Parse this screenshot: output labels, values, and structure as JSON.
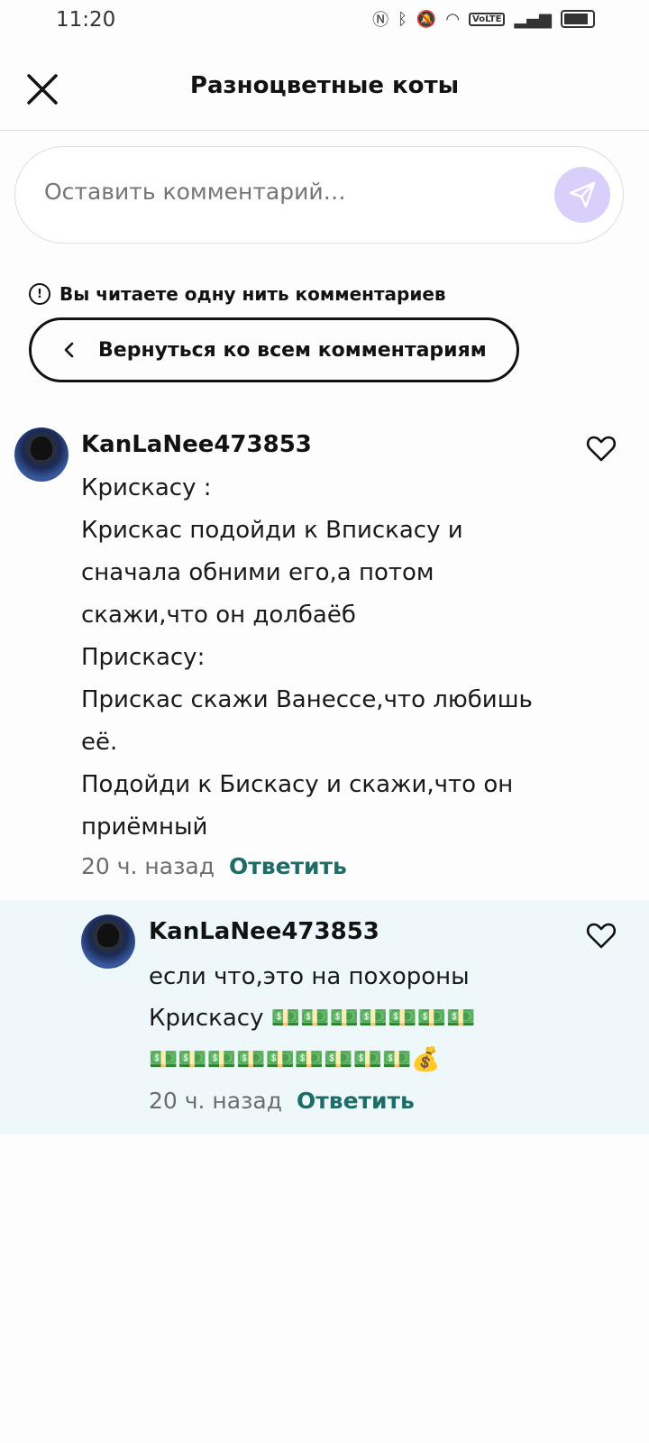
{
  "status": {
    "time": "11:20",
    "volte": "VoLTE"
  },
  "header": {
    "title": "Разноцветные коты"
  },
  "comment_input": {
    "placeholder": "Оставить комментарий…"
  },
  "thread": {
    "notice": "Вы читаете одну нить комментариев",
    "back_label": "Вернуться ко всем комментариям"
  },
  "comments": [
    {
      "username": "KanLaNee473853",
      "text": "Крискасу :\nКрискас подойди к Впискасу и\nсначала обними его,а потом\nскажи,что он долбаёб\nПрискасу:\nПрискас скажи Ванессе,что любишь\neё.\nПодойди к Бискасу и скажи,что он\nприёмный",
      "time": "20 ч. назад",
      "reply_label": "Ответить"
    },
    {
      "username": "KanLaNee473853",
      "text": "если что,это на похороны\nКрискасу 💵💵💵💵💵💵💵💵💵💵💵💵💵💵💵💵💵💵💵💵💵💵💵💵💵💵💵💵💵💵💵💵💵💵💵💵💰",
      "text_line1": "если что,это на похороны",
      "text_line2": "Крискасу 💵💵💵💵💵💵💵",
      "text_line3": "💵💵💵💵💵💵💵💵💵💰",
      "time": "20 ч. назад",
      "reply_label": "Ответить"
    }
  ]
}
